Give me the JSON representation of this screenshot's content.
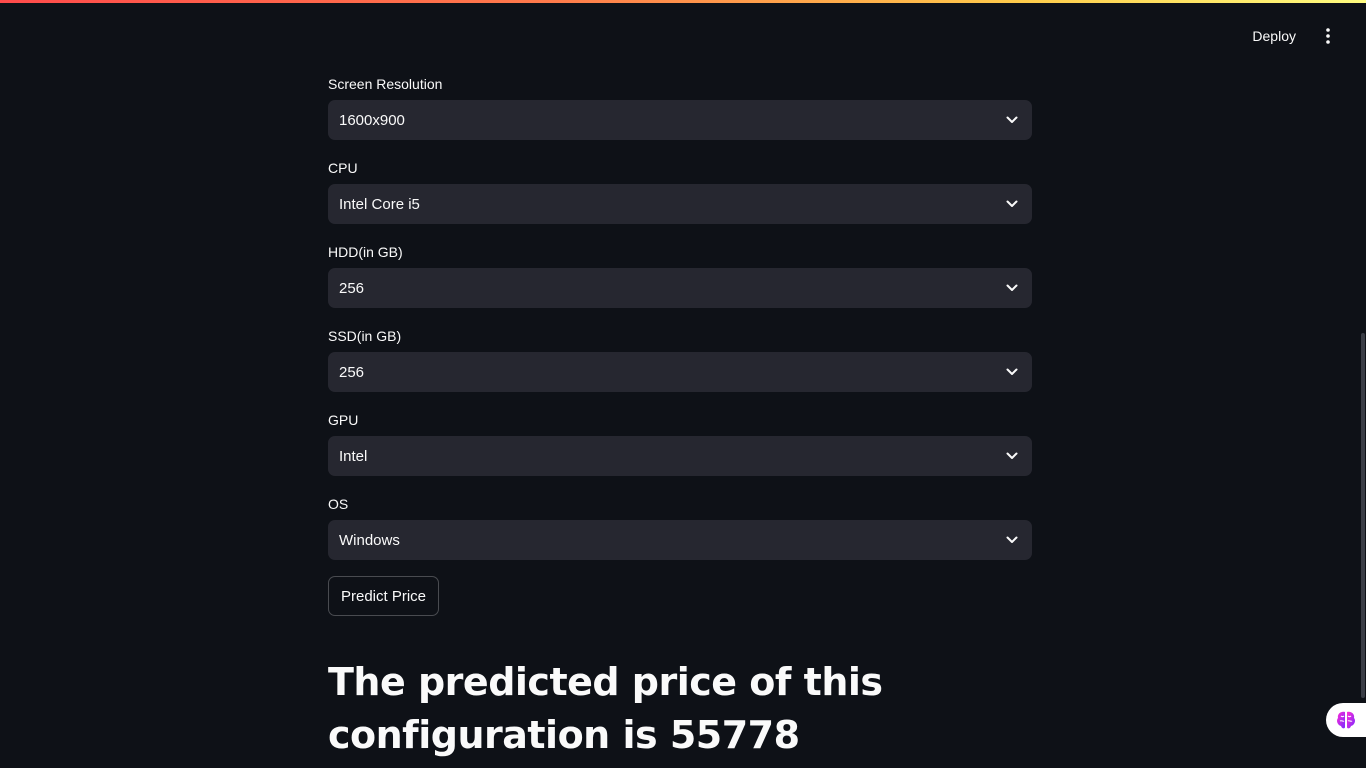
{
  "header": {
    "deploy_label": "Deploy",
    "menu_icon": "vertical-dots-icon"
  },
  "form": {
    "fields": [
      {
        "label": "Screen Resolution",
        "value": "1600x900"
      },
      {
        "label": "CPU",
        "value": "Intel Core i5"
      },
      {
        "label": "HDD(in GB)",
        "value": "256"
      },
      {
        "label": "SSD(in GB)",
        "value": "256"
      },
      {
        "label": "GPU",
        "value": "Intel"
      },
      {
        "label": "OS",
        "value": "Windows"
      }
    ],
    "predict_label": "Predict Price"
  },
  "result": {
    "text": "The predicted price of this configuration is 55778"
  },
  "colors": {
    "background": "#0e1117",
    "select_bg": "#262730",
    "text": "#fafafa",
    "accent_gradient_start": "#ff4b4b",
    "accent_gradient_end": "#fffd80"
  },
  "badge": {
    "icon": "brain-icon"
  }
}
